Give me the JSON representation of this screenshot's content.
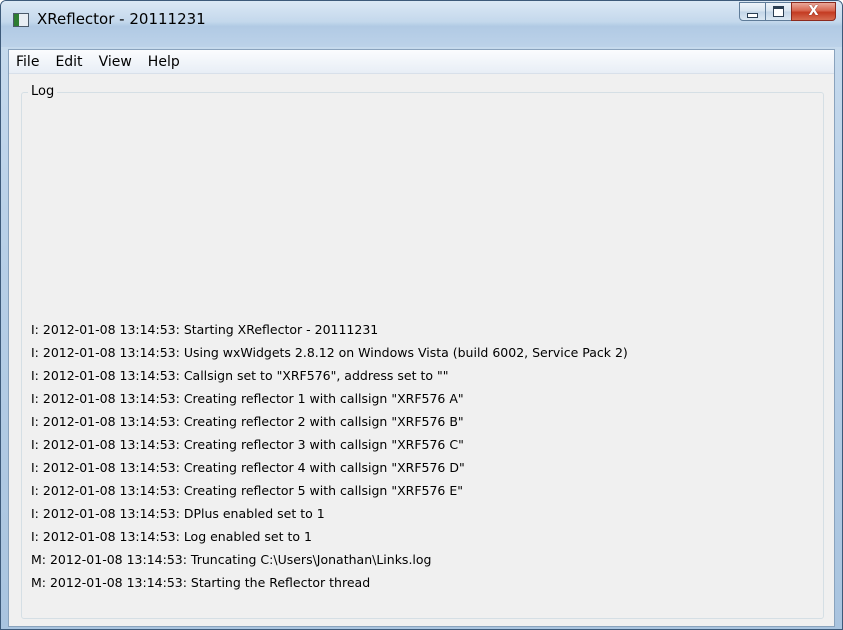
{
  "window": {
    "title": "XReflector - 20111231",
    "icon": "app-icon",
    "controls": {
      "minimize_icon": "minimize-icon",
      "maximize_icon": "maximize-icon",
      "close_glyph": "X"
    }
  },
  "menubar": {
    "items": [
      {
        "label": "File"
      },
      {
        "label": "Edit"
      },
      {
        "label": "View"
      },
      {
        "label": "Help"
      }
    ]
  },
  "log": {
    "label": "Log",
    "lines": [
      "I: 2012-01-08 13:14:53: Starting XReflector - 20111231",
      "I: 2012-01-08 13:14:53: Using wxWidgets 2.8.12 on Windows Vista (build 6002, Service Pack 2)",
      "I: 2012-01-08 13:14:53: Callsign set to \"XRF576\", address set to \"\"",
      "I: 2012-01-08 13:14:53: Creating reflector 1 with callsign \"XRF576 A\"",
      "I: 2012-01-08 13:14:53: Creating reflector 2 with callsign \"XRF576 B\"",
      "I: 2012-01-08 13:14:53: Creating reflector 3 with callsign \"XRF576 C\"",
      "I: 2012-01-08 13:14:53: Creating reflector 4 with callsign \"XRF576 D\"",
      "I: 2012-01-08 13:14:53: Creating reflector 5 with callsign \"XRF576 E\"",
      "I: 2012-01-08 13:14:53: DPlus enabled set to 1",
      "I: 2012-01-08 13:14:53: Log enabled set to 1",
      "M: 2012-01-08 13:14:53: Truncating C:\\Users\\Jonathan\\Links.log",
      "M: 2012-01-08 13:14:53: Starting the Reflector thread"
    ]
  },
  "colors": {
    "titlebar": "#c4d8ec",
    "close_button": "#c43b22",
    "client_bg": "#f0f0f0"
  }
}
